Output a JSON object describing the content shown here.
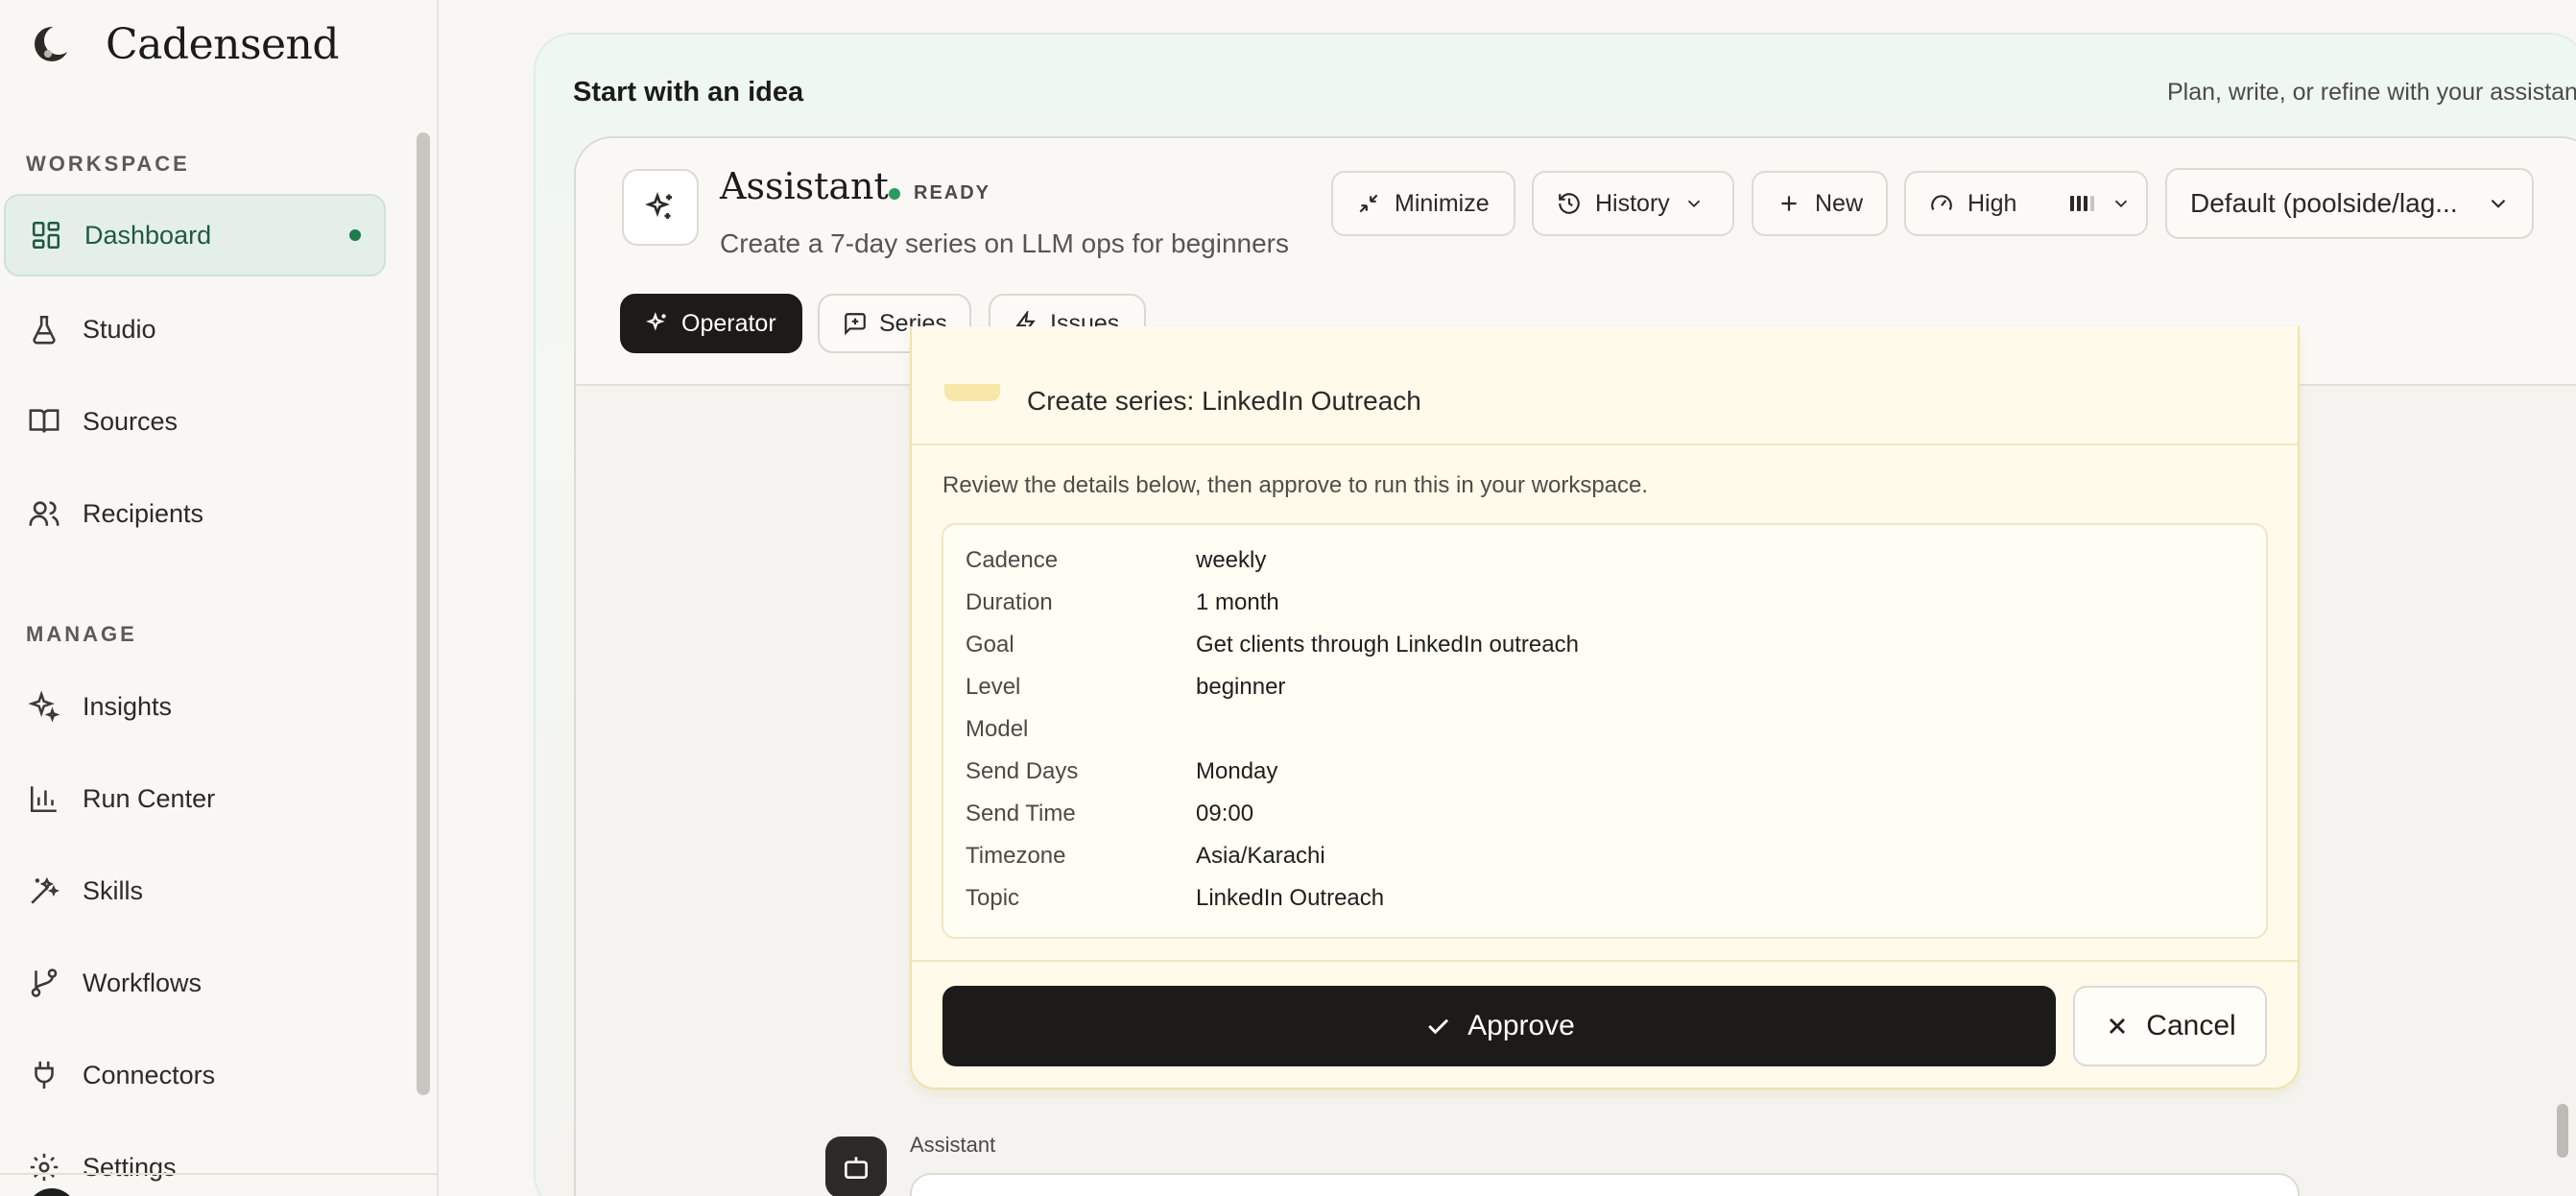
{
  "brand": {
    "name": "Cadensend",
    "logo_icon": "crescent-logo-icon"
  },
  "sidebar": {
    "sections": [
      {
        "title": "WORKSPACE"
      },
      {
        "title": "MANAGE"
      }
    ],
    "items": [
      {
        "label": "Dashboard",
        "icon": "dashboard-icon",
        "active": true
      },
      {
        "label": "Studio",
        "icon": "flask-icon"
      },
      {
        "label": "Sources",
        "icon": "book-icon"
      },
      {
        "label": "Recipients",
        "icon": "users-icon"
      },
      {
        "label": "Insights",
        "icon": "sparkles-icon"
      },
      {
        "label": "Run Center",
        "icon": "bar-chart-icon"
      },
      {
        "label": "Skills",
        "icon": "wand-icon"
      },
      {
        "label": "Workflows",
        "icon": "git-branch-icon"
      },
      {
        "label": "Connectors",
        "icon": "plug-icon"
      },
      {
        "label": "Settings",
        "icon": "gear-icon"
      }
    ]
  },
  "main": {
    "title": "Start with an idea",
    "subtitle": "Plan, write, or refine with your assistant"
  },
  "assistant": {
    "title": "Assistant",
    "status": "READY",
    "subtitle": "Create a 7-day series on LLM ops for beginners",
    "toolbar": {
      "minimize": "Minimize",
      "history": "History",
      "new": "New",
      "effort": "High",
      "model": "Default (poolside/lag..."
    },
    "tabs": [
      {
        "label": "Operator",
        "active": true
      },
      {
        "label": "Series"
      },
      {
        "label": "Issues"
      }
    ]
  },
  "action_card": {
    "title": "Create series: LinkedIn Outreach",
    "description": "Review the details below, then approve to run this in your workspace.",
    "details": [
      {
        "key": "Cadence",
        "value": "weekly"
      },
      {
        "key": "Duration",
        "value": "1 month"
      },
      {
        "key": "Goal",
        "value": "Get clients through LinkedIn outreach"
      },
      {
        "key": "Level",
        "value": "beginner"
      },
      {
        "key": "Model",
        "value": ""
      },
      {
        "key": "Send Days",
        "value": "Monday"
      },
      {
        "key": "Send Time",
        "value": "09:00"
      },
      {
        "key": "Timezone",
        "value": "Asia/Karachi"
      },
      {
        "key": "Topic",
        "value": "LinkedIn Outreach"
      }
    ],
    "approve_label": "Approve",
    "cancel_label": "Cancel"
  },
  "message": {
    "sender": "Assistant"
  },
  "colors": {
    "accent_green": "#1f7a4c",
    "active_nav_bg": "#e5efe9",
    "card_bg": "#fffaea",
    "primary_button": "#1c1b19"
  }
}
